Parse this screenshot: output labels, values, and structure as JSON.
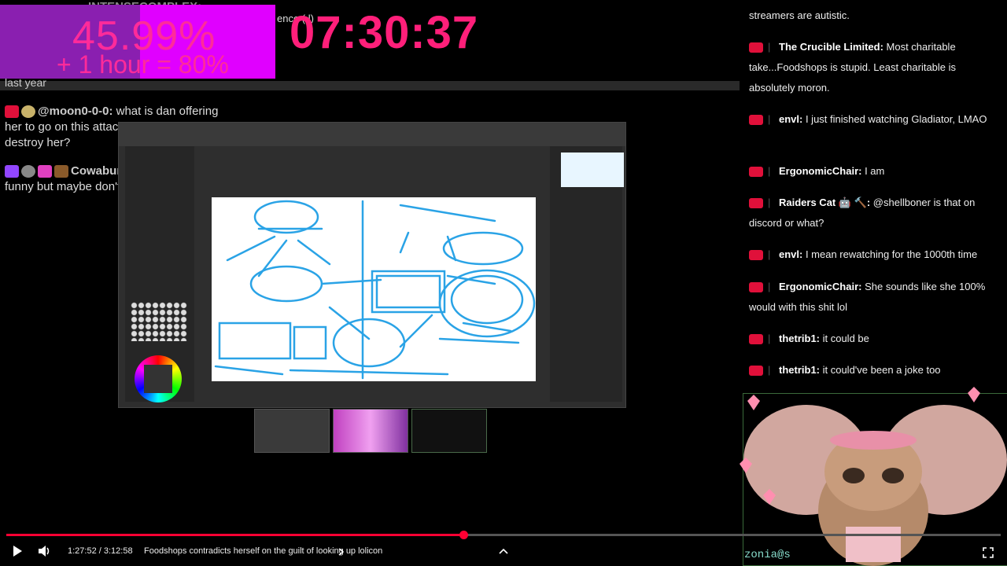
{
  "overlay": {
    "top_name": "INTENSECOMPLEX:",
    "top_fragment": "ence ( l)",
    "percent": "45.99%",
    "percent_sub": "+ 1 hour = 80%",
    "timer": "07:30:37",
    "colors": {
      "box": "#e000ff",
      "text": "#ff2b9a",
      "timer": "#ff1f7a"
    }
  },
  "left_chat": {
    "prev_line": "last year",
    "messages": [
      {
        "author": "@moon0-0-0:",
        "text": " what is dan offering her to go on this attack that will only destroy her?"
      },
      {
        "author": "CowabungaAndy:",
        "text": " It would be funny but maybe don't"
      }
    ]
  },
  "right_chat": {
    "top_fragment": "streamers are autistic.",
    "messages": [
      {
        "author": "The Crucible Limited:",
        "text": " Most charitable take...Foodshops is stupid. Least charitable is absolutely moron."
      },
      {
        "author": "envl:",
        "text": " I just finished watching Gladiator, LMAO"
      },
      {
        "author": "ErgonomicChair:",
        "text": " I am"
      },
      {
        "author": "Raiders Cat 🤖 🔨:",
        "text": " @shellboner is that on discord or what?"
      },
      {
        "author": "envl:",
        "text": " I mean rewatching for the 1000th time"
      },
      {
        "author": "ErgonomicChair:",
        "text": " She sounds like she 100% would with this shit lol"
      },
      {
        "author": "thetrib1:",
        "text": " it could be"
      },
      {
        "author": "thetrib1:",
        "text": " it could've been a joke too"
      }
    ]
  },
  "mascot": {
    "label": "zonia@s"
  },
  "player": {
    "time": "1:27:52 / 3:12:58",
    "title": "Foodshops contradicts herself on the guilt of looking up lolicon",
    "progress": 0.46,
    "icons": [
      "play-icon",
      "volume-icon",
      "chevron-right-icon",
      "chevron-up-icon",
      "fullscreen-icon"
    ]
  }
}
